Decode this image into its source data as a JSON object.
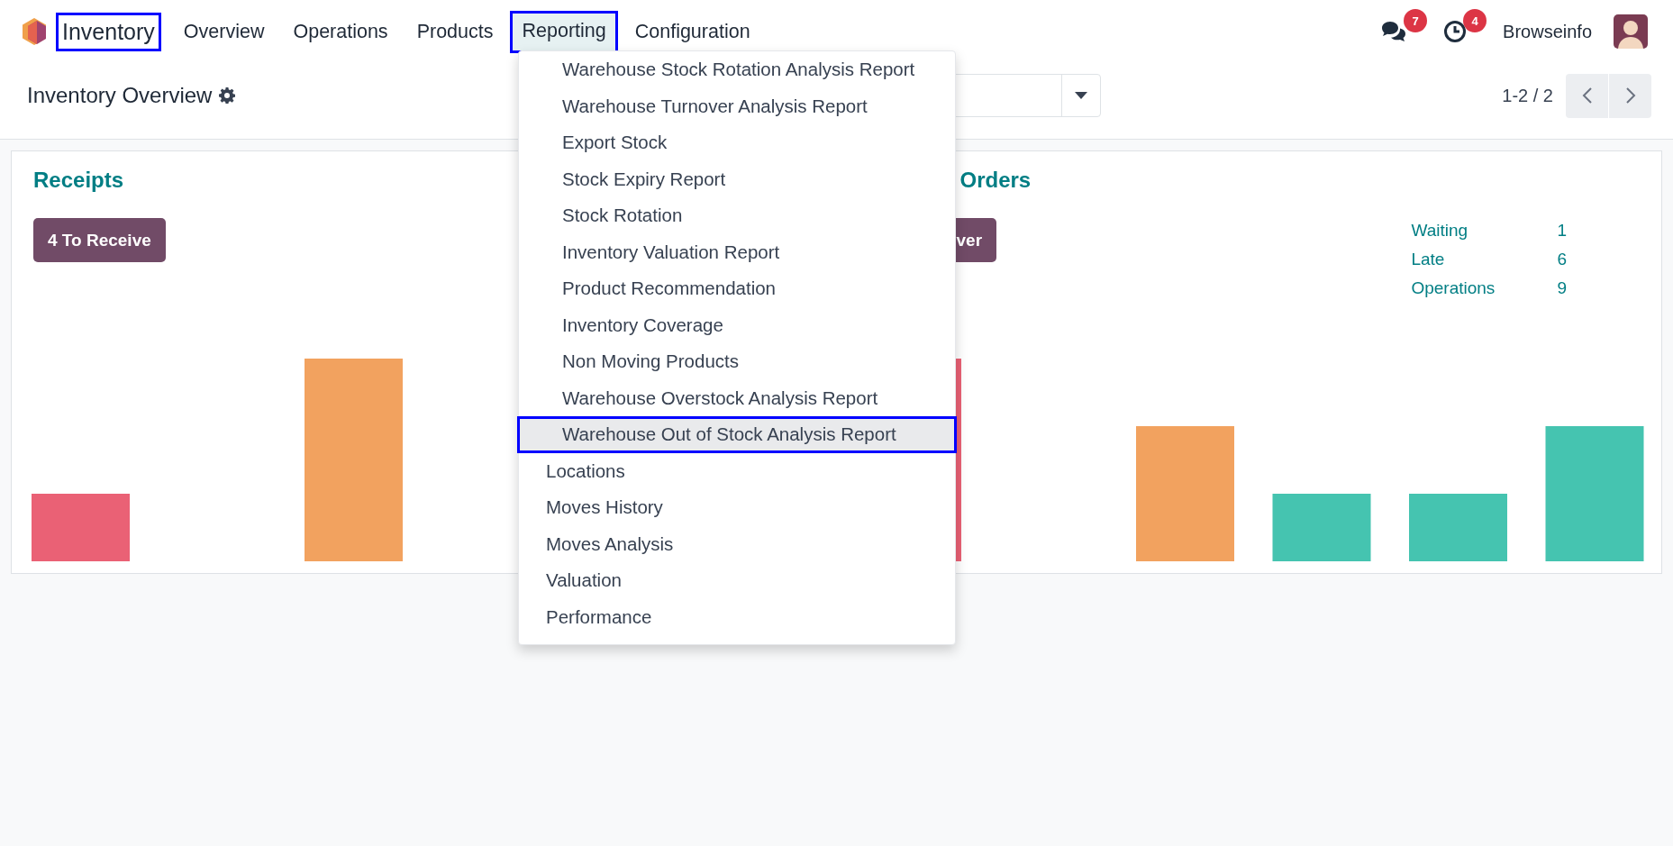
{
  "navbar": {
    "app": {
      "label": "Inventory",
      "annotated": true
    },
    "menus": [
      {
        "label": "Overview",
        "selected": false,
        "annotated": false
      },
      {
        "label": "Operations",
        "selected": false,
        "annotated": false
      },
      {
        "label": "Products",
        "selected": false,
        "annotated": false
      },
      {
        "label": "Reporting",
        "selected": true,
        "annotated": true
      },
      {
        "label": "Configuration",
        "selected": false,
        "annotated": false
      }
    ],
    "messages_badge": "7",
    "activities_badge": "4",
    "user": "Browseinfo"
  },
  "control_panel": {
    "title": "Inventory Overview",
    "pager": "1-2 / 2"
  },
  "cards": [
    {
      "title": "Receipts",
      "button": "4 To Receive"
    },
    {
      "title": "Orders",
      "button": "ver",
      "stats": [
        {
          "label": "Waiting",
          "value": "1"
        },
        {
          "label": "Late",
          "value": "6"
        },
        {
          "label": "Operations",
          "value": "9"
        }
      ]
    }
  ],
  "reporting_menu": {
    "items": [
      {
        "label": "Warehouse Stock Rotation Analysis Report",
        "indented": true,
        "selected": false,
        "annotated": false
      },
      {
        "label": "Warehouse Turnover Analysis Report",
        "indented": true,
        "selected": false,
        "annotated": false
      },
      {
        "label": "Export Stock",
        "indented": true,
        "selected": false,
        "annotated": false
      },
      {
        "label": "Stock Expiry Report",
        "indented": true,
        "selected": false,
        "annotated": false
      },
      {
        "label": "Stock Rotation",
        "indented": true,
        "selected": false,
        "annotated": false
      },
      {
        "label": "Inventory Valuation Report",
        "indented": true,
        "selected": false,
        "annotated": false
      },
      {
        "label": "Product Recommendation",
        "indented": true,
        "selected": false,
        "annotated": false
      },
      {
        "label": "Inventory Coverage",
        "indented": true,
        "selected": false,
        "annotated": false
      },
      {
        "label": "Non Moving Products",
        "indented": true,
        "selected": false,
        "annotated": false
      },
      {
        "label": "Warehouse Overstock Analysis Report",
        "indented": true,
        "selected": false,
        "annotated": false
      },
      {
        "label": "Warehouse Out of Stock Analysis Report",
        "indented": true,
        "selected": true,
        "annotated": true
      },
      {
        "label": "Locations",
        "indented": false,
        "selected": false,
        "annotated": false
      },
      {
        "label": "Moves History",
        "indented": false,
        "selected": false,
        "annotated": false
      },
      {
        "label": "Moves Analysis",
        "indented": false,
        "selected": false,
        "annotated": false
      },
      {
        "label": "Valuation",
        "indented": false,
        "selected": false,
        "annotated": false
      },
      {
        "label": "Performance",
        "indented": false,
        "selected": false,
        "annotated": false
      }
    ]
  }
}
